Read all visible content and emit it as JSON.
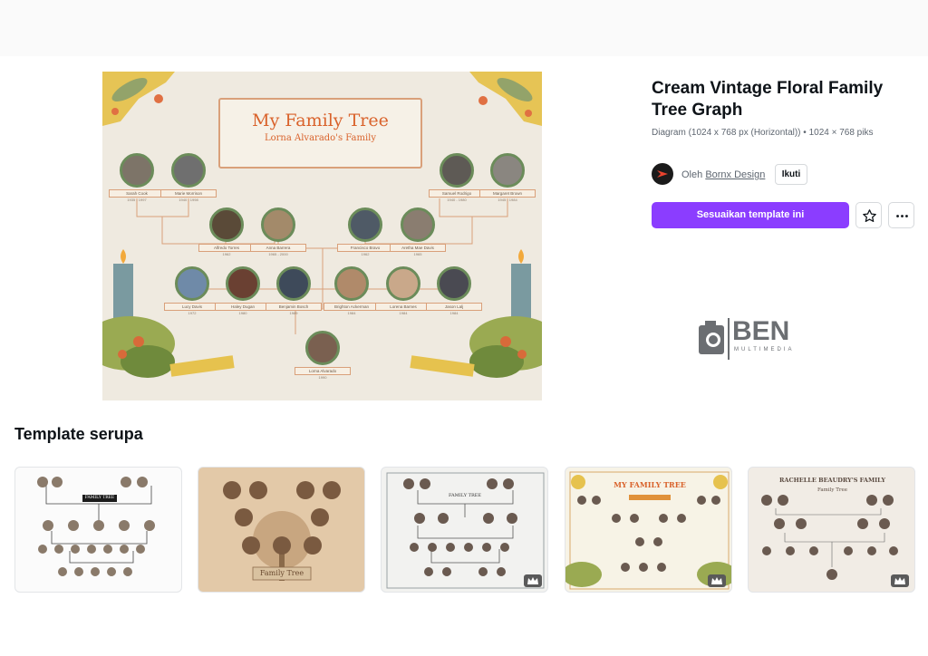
{
  "preview": {
    "title": "My Family Tree",
    "subtitle": "Lorna Alvarado's Family",
    "people": [
      {
        "name": "Sarah Cook",
        "date": "1935 - 1997"
      },
      {
        "name": "Marie Morrison",
        "date": "1940 - 1998"
      },
      {
        "name": "Samuel Rodrigo",
        "date": "1940 - 1980"
      },
      {
        "name": "Margaret Brown",
        "date": "1945 - 1984"
      },
      {
        "name": "Alfredo Torres",
        "date": "1962"
      },
      {
        "name": "Anna Barrera",
        "date": "1965 - 2000"
      },
      {
        "name": "Francisco Bravo",
        "date": "1962"
      },
      {
        "name": "Aretha Mae Davis",
        "date": "1965"
      },
      {
        "name": "Lucy Davis",
        "date": "1972"
      },
      {
        "name": "Haley Dugan",
        "date": "1980"
      },
      {
        "name": "Benjamin Bosch",
        "date": "1989"
      },
      {
        "name": "Brighton Ackerman",
        "date": "1984"
      },
      {
        "name": "Lorena Barnes",
        "date": "1984"
      },
      {
        "name": "Jason Lalj",
        "date": "1984"
      },
      {
        "name": "Lorna Alvarado",
        "date": "1990"
      }
    ]
  },
  "details": {
    "title": "Cream Vintage Floral Family Tree Graph",
    "meta": "Diagram (1024 x 768 px (Horizontal)) • 1024 × 768 piks",
    "author_prefix": "Oleh",
    "author_name": "Bornx Design",
    "follow_label": "Ikuti",
    "customize_label": "Sesuaikan template ini"
  },
  "watermark": {
    "big": "BEN",
    "small": "MULTIMEDIA"
  },
  "similar": {
    "title": "Template serupa",
    "items": [
      {
        "label": "FAMILY TREE"
      },
      {
        "label": "Family Tree"
      },
      {
        "label": "FAMILY TREE"
      },
      {
        "label": "MY FAMILY TREE"
      },
      {
        "label": "RACHELLE BEAUDRY'S FAMILY",
        "sublabel": "Family Tree"
      }
    ]
  },
  "colors": {
    "accent": "#8b3dff",
    "preview_bg": "#efeae0",
    "title_orange": "#d9622b"
  }
}
